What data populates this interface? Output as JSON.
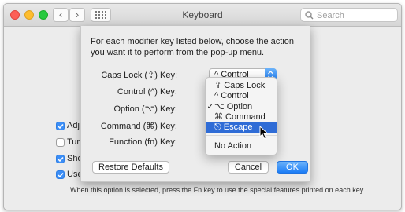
{
  "window": {
    "title": "Keyboard",
    "search_placeholder": "Search",
    "nav_back": "‹",
    "nav_forward": "›"
  },
  "background": {
    "checkboxes": [
      {
        "label": "Adj",
        "checked": true
      },
      {
        "label": "Tur",
        "checked": false
      },
      {
        "label": "Sho",
        "checked": true
      },
      {
        "label": "Use",
        "checked": true
      }
    ],
    "footnote": "When this option is selected, press the Fn key to use the special features printed on each key."
  },
  "sheet": {
    "intro": "For each modifier key listed below, choose the action you want it to perform from the pop-up menu.",
    "rows": [
      {
        "label": "Caps Lock (⇪) Key:",
        "value": "^ Control"
      },
      {
        "label": "Control (^) Key:",
        "value": ""
      },
      {
        "label": "Option (⌥) Key:",
        "value": ""
      },
      {
        "label": "Command (⌘) Key:",
        "value": ""
      },
      {
        "label": "Function (fn) Key:",
        "value": ""
      }
    ],
    "restore_label": "Restore Defaults",
    "cancel_label": "Cancel",
    "ok_label": "OK"
  },
  "menu": {
    "items": [
      {
        "label": "⇪ Caps Lock",
        "check": "",
        "highlighted": false
      },
      {
        "label": "^ Control",
        "check": "",
        "highlighted": false
      },
      {
        "label": "⌥ Option",
        "check": "✓",
        "highlighted": false
      },
      {
        "label": "⌘ Command",
        "check": "",
        "highlighted": false
      },
      {
        "label": "⎋ Escape",
        "check": "",
        "highlighted": true
      },
      {
        "label": "No Action",
        "check": "",
        "highlighted": false
      }
    ]
  },
  "colors": {
    "accent": "#1b7cf6",
    "highlight": "#2f6cd6"
  }
}
